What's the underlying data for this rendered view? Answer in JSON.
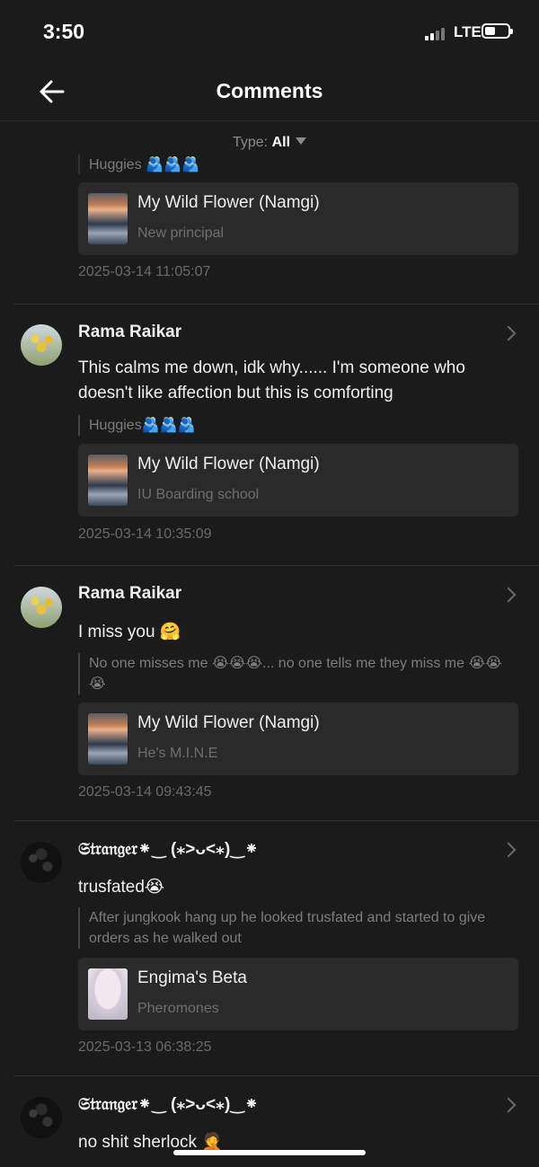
{
  "status": {
    "time": "3:50",
    "network": "LTE"
  },
  "nav": {
    "title": "Comments"
  },
  "filter": {
    "label": "Type:",
    "value": "All"
  },
  "partial_top": {
    "quote": "Huggies 🫂🫂🫂",
    "card": {
      "title": "My Wild Flower (Namgi)",
      "subtitle": "New principal"
    },
    "date": "2025-03-14 11:05:07"
  },
  "comments": [
    {
      "user": "Rama Raikar",
      "text": "This calms me down, idk why...... I'm someone who doesn't like affection but this is comforting",
      "quote": "Huggies🫂🫂🫂",
      "card": {
        "title": "My Wild Flower (Namgi)",
        "subtitle": "IU Boarding school"
      },
      "date": "2025-03-14 10:35:09"
    },
    {
      "user": "Rama Raikar",
      "text": "I miss you 🤗",
      "quote": "No one misses me 😭😭😭... no one tells me they miss me 😭😭😭",
      "card": {
        "title": "My Wild Flower (Namgi)",
        "subtitle": "He's M.I.N.E"
      },
      "date": "2025-03-14 09:43:45"
    },
    {
      "user": "𝔖𝔱𝔯𝔞𝔫𝔤𝔢𝔯⁕‿ (⁎˃ᴗ˂⁎)‿⁕",
      "text": "trusfated😭",
      "quote": "After jungkook hang up he looked trusfated and started to give orders as he walked out",
      "card": {
        "title": "Engima's Beta",
        "subtitle": "Pheromones"
      },
      "date": "2025-03-13 06:38:25"
    },
    {
      "user": "𝔖𝔱𝔯𝔞𝔫𝔤𝔢𝔯⁕‿ (⁎˃ᴗ˂⁎)‿⁕",
      "text": "no shit sherlock 🤦"
    }
  ]
}
